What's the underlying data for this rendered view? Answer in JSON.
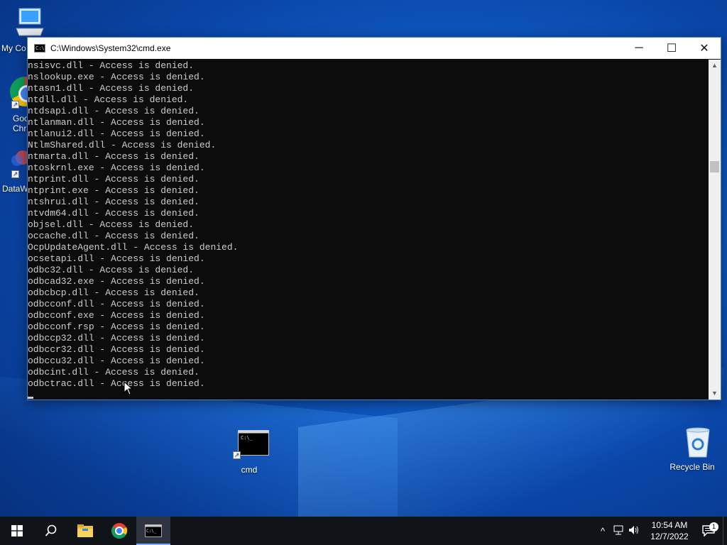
{
  "desktop": {
    "icons": [
      {
        "label": "My Co",
        "icon": "computer-icon"
      },
      {
        "label": "Goo Chr",
        "icon": "chrome-icon"
      },
      {
        "label": "DataW",
        "icon": "datawrapper-icon"
      },
      {
        "label": "cmd",
        "icon": "cmd-icon"
      },
      {
        "label": "Recycle Bin",
        "icon": "recycle-bin-icon"
      }
    ]
  },
  "cmd_window": {
    "title": "C:\\Windows\\System32\\cmd.exe",
    "minimize": "─",
    "maximize": "☐",
    "close": "✕",
    "lines": [
      "nsisvc.dll - Access is denied.",
      "nslookup.exe - Access is denied.",
      "ntasn1.dll - Access is denied.",
      "ntdll.dll - Access is denied.",
      "ntdsapi.dll - Access is denied.",
      "ntlanman.dll - Access is denied.",
      "ntlanui2.dll - Access is denied.",
      "NtlmShared.dll - Access is denied.",
      "ntmarta.dll - Access is denied.",
      "ntoskrnl.exe - Access is denied.",
      "ntprint.dll - Access is denied.",
      "ntprint.exe - Access is denied.",
      "ntshrui.dll - Access is denied.",
      "ntvdm64.dll - Access is denied.",
      "objsel.dll - Access is denied.",
      "occache.dll - Access is denied.",
      "OcpUpdateAgent.dll - Access is denied.",
      "ocsetapi.dll - Access is denied.",
      "odbc32.dll - Access is denied.",
      "odbcad32.exe - Access is denied.",
      "odbcbcp.dll - Access is denied.",
      "odbcconf.dll - Access is denied.",
      "odbcconf.exe - Access is denied.",
      "odbcconf.rsp - Access is denied.",
      "odbccp32.dll - Access is denied.",
      "odbccr32.dll - Access is denied.",
      "odbccu32.dll - Access is denied.",
      "odbcint.dll - Access is denied.",
      "odbctrac.dll - Access is denied."
    ]
  },
  "taskbar": {
    "start_icon": "windows-start-icon",
    "search_icon": "search-icon",
    "pinned": [
      "file-explorer-icon",
      "chrome-icon",
      "cmd-icon"
    ],
    "tray_icons": [
      "chevron-up-icon",
      "network-icon",
      "volume-icon"
    ],
    "time": "10:54 AM",
    "date": "12/7/2022",
    "notification_count": "1"
  },
  "colors": {
    "console_bg": "#0c0c0c",
    "console_fg": "#cccccc",
    "taskbar_bg": "#101318",
    "wallpaper": "#0f5fc9"
  }
}
